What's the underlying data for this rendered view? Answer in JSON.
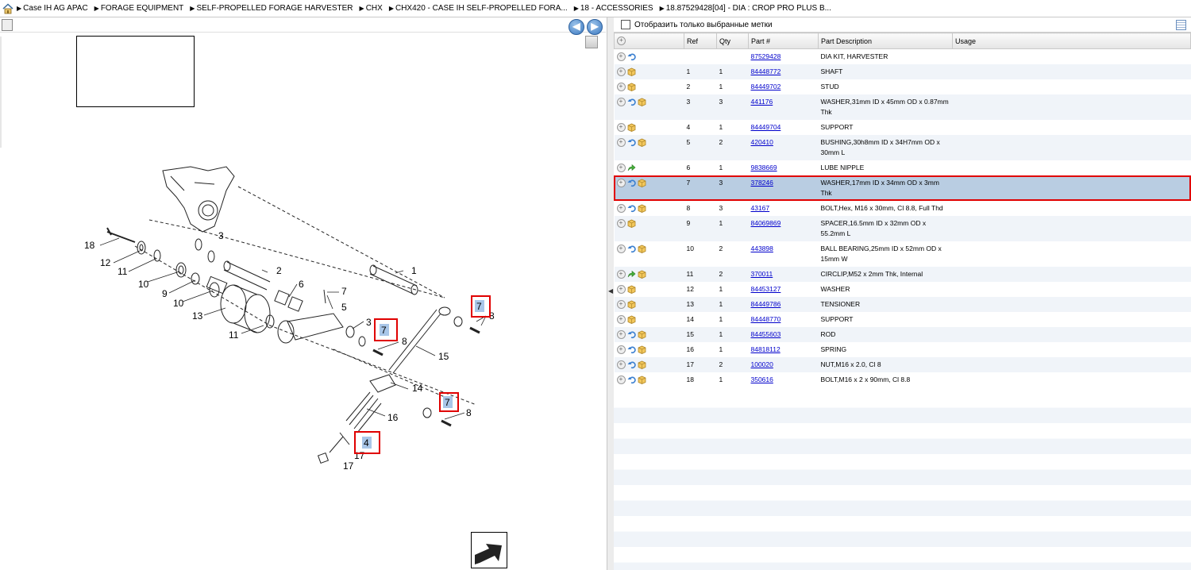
{
  "breadcrumb": [
    "Case IH AG APAC",
    "FORAGE EQUIPMENT",
    "SELF-PROPELLED FORAGE HARVESTER",
    "CHX",
    "CHX420 - CASE IH SELF-PROPELLED FORA...",
    "18 - ACCESSORIES",
    "18.87529428[04] - DIA : CROP PRO PLUS B..."
  ],
  "nav": {
    "back": "◀",
    "forward": "▶"
  },
  "filter": {
    "label": "Отобразить только выбранные метки",
    "checked": false
  },
  "table": {
    "headers": [
      "Ref",
      "Qty",
      "Part #",
      "Part Description",
      "Usage"
    ],
    "rows": [
      {
        "ref": "",
        "qty": "",
        "part": "87529428",
        "desc": "DIA KIT, HARVESTER",
        "icons": [
          "undo"
        ]
      },
      {
        "ref": "1",
        "qty": "1",
        "part": "84448772",
        "desc": "SHAFT",
        "icons": [
          "box"
        ]
      },
      {
        "ref": "2",
        "qty": "1",
        "part": "84449702",
        "desc": "STUD",
        "icons": [
          "box"
        ]
      },
      {
        "ref": "3",
        "qty": "3",
        "part": "441176",
        "desc": "WASHER,31mm ID x 45mm OD x 0.87mm Thk",
        "icons": [
          "undo",
          "box"
        ]
      },
      {
        "ref": "4",
        "qty": "1",
        "part": "84449704",
        "desc": "SUPPORT",
        "icons": [
          "box"
        ]
      },
      {
        "ref": "5",
        "qty": "2",
        "part": "420410",
        "desc": "BUSHING,30h8mm ID x 34H7mm OD x 30mm L",
        "icons": [
          "undo",
          "box"
        ]
      },
      {
        "ref": "6",
        "qty": "1",
        "part": "9838669",
        "desc": "LUBE NIPPLE",
        "icons": [
          "green"
        ]
      },
      {
        "ref": "7",
        "qty": "3",
        "part": "378246",
        "desc": "WASHER,17mm ID x 34mm OD x 3mm Thk",
        "icons": [
          "undo",
          "box"
        ],
        "selected": true
      },
      {
        "ref": "8",
        "qty": "3",
        "part": "43167",
        "desc": "BOLT,Hex, M16 x 30mm, Cl 8.8, Full Thd",
        "icons": [
          "undo",
          "box"
        ]
      },
      {
        "ref": "9",
        "qty": "1",
        "part": "84069869",
        "desc": "SPACER,16.5mm ID x 32mm OD x 55.2mm L",
        "icons": [
          "box"
        ]
      },
      {
        "ref": "10",
        "qty": "2",
        "part": "443898",
        "desc": "BALL BEARING,25mm ID x 52mm OD x 15mm W",
        "icons": [
          "undo",
          "box"
        ]
      },
      {
        "ref": "11",
        "qty": "2",
        "part": "370011",
        "desc": "CIRCLIP,M52 x 2mm Thk, Internal",
        "icons": [
          "green",
          "box"
        ]
      },
      {
        "ref": "12",
        "qty": "1",
        "part": "84453127",
        "desc": "WASHER",
        "icons": [
          "box"
        ]
      },
      {
        "ref": "13",
        "qty": "1",
        "part": "84449786",
        "desc": "TENSIONER",
        "icons": [
          "box"
        ]
      },
      {
        "ref": "14",
        "qty": "1",
        "part": "84448770",
        "desc": "SUPPORT",
        "icons": [
          "box"
        ]
      },
      {
        "ref": "15",
        "qty": "1",
        "part": "84455603",
        "desc": "ROD",
        "icons": [
          "undo",
          "box"
        ]
      },
      {
        "ref": "16",
        "qty": "1",
        "part": "84818112",
        "desc": "SPRING",
        "icons": [
          "undo",
          "box"
        ]
      },
      {
        "ref": "17",
        "qty": "2",
        "part": "100020",
        "desc": "NUT,M16 x 2.0, Cl 8",
        "icons": [
          "undo",
          "box"
        ]
      },
      {
        "ref": "18",
        "qty": "1",
        "part": "350616",
        "desc": "BOLT,M16 x 2 x 90mm, Cl 8.8",
        "icons": [
          "undo",
          "box"
        ]
      }
    ]
  },
  "diagram": {
    "callouts": [
      "1",
      "2",
      "3",
      "3",
      "4",
      "5",
      "6",
      "7",
      "7",
      "7",
      "7",
      "8",
      "8",
      "8",
      "9",
      "10",
      "10",
      "11",
      "11",
      "12",
      "13",
      "14",
      "15",
      "16",
      "17",
      "17",
      "18"
    ],
    "highlight_color": "#e00000"
  }
}
